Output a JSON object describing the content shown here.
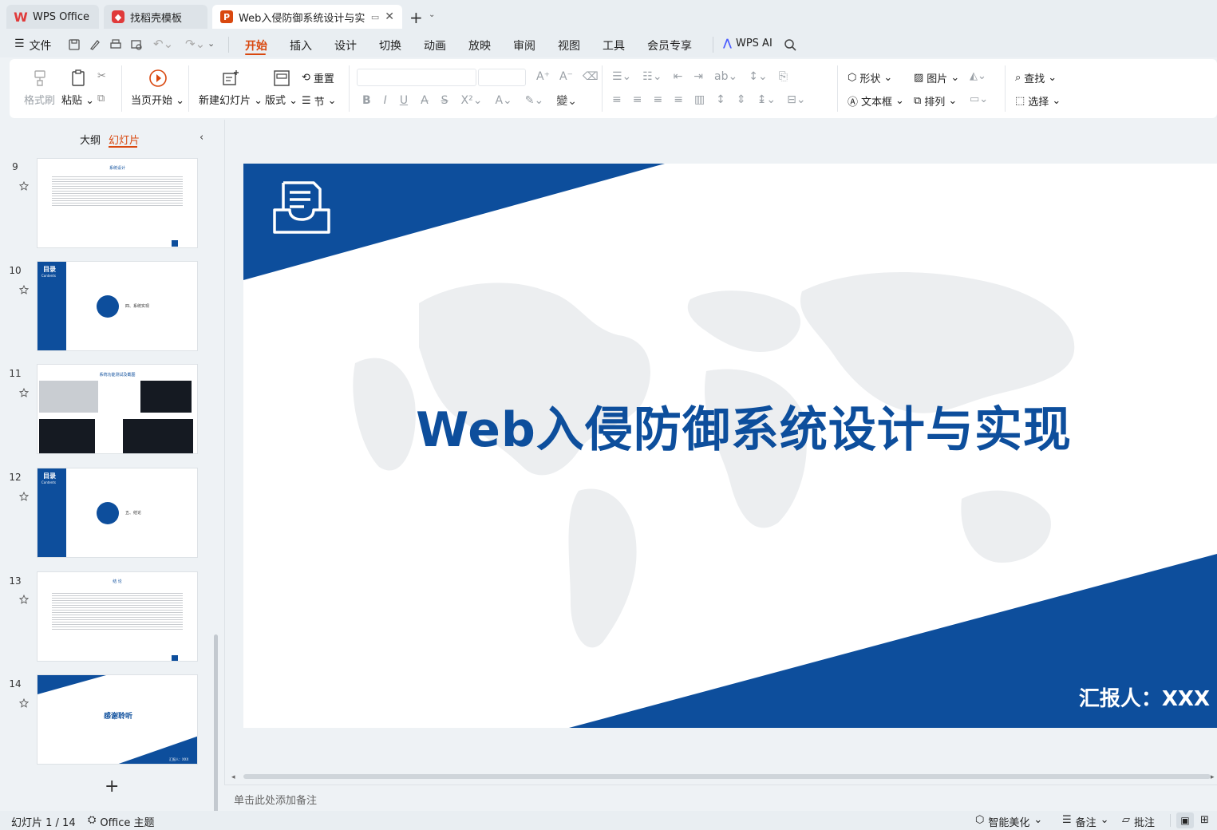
{
  "tabs": [
    {
      "label": "WPS Office",
      "icon": "wps-logo-icon"
    },
    {
      "label": "找稻壳模板",
      "icon": "docer-icon"
    },
    {
      "label": "Web入侵防御系统设计与实现",
      "icon": "presentation-icon"
    }
  ],
  "menu": {
    "file": "文件",
    "items": [
      "开始",
      "插入",
      "设计",
      "切换",
      "动画",
      "放映",
      "审阅",
      "视图",
      "工具",
      "会员专享"
    ],
    "active": "开始",
    "wps_ai": "WPS AI"
  },
  "ribbon": {
    "format_painter": "格式刷",
    "paste": "粘贴",
    "from_current": "当页开始",
    "new_slide": "新建幻灯片",
    "layout": "版式",
    "reset": "重置",
    "section": "节",
    "shape": "形状",
    "picture": "图片",
    "textbox": "文本框",
    "arrange": "排列",
    "find": "查找",
    "select": "选择"
  },
  "left_panel": {
    "tab_outline": "大纲",
    "tab_slides": "幻灯片",
    "slides": [
      {
        "num": "9",
        "title": "系统设计"
      },
      {
        "num": "10",
        "label": "目录",
        "sub": "Contents",
        "text": "四、系统实现"
      },
      {
        "num": "11",
        "title": "系统功能测试及截图"
      },
      {
        "num": "12",
        "label": "目录",
        "sub": "Contents",
        "text": "五、结论"
      },
      {
        "num": "13",
        "title": "结 论"
      },
      {
        "num": "14",
        "title": "感谢聆听",
        "reporter": "汇报人：XXX"
      }
    ]
  },
  "slide": {
    "title": "Web入侵防御系统设计与实现",
    "reporter": "汇报人：XXX"
  },
  "notes_placeholder": "单击此处添加备注",
  "status": {
    "slide_counter": "幻灯片 1 / 14",
    "theme": "Office 主题",
    "smart_beautify": "智能美化",
    "notes": "备注",
    "comments": "批注"
  },
  "colors": {
    "brand_blue": "#0d4e9c",
    "accent_orange": "#d9480f",
    "wps_red": "#e03a3a"
  }
}
